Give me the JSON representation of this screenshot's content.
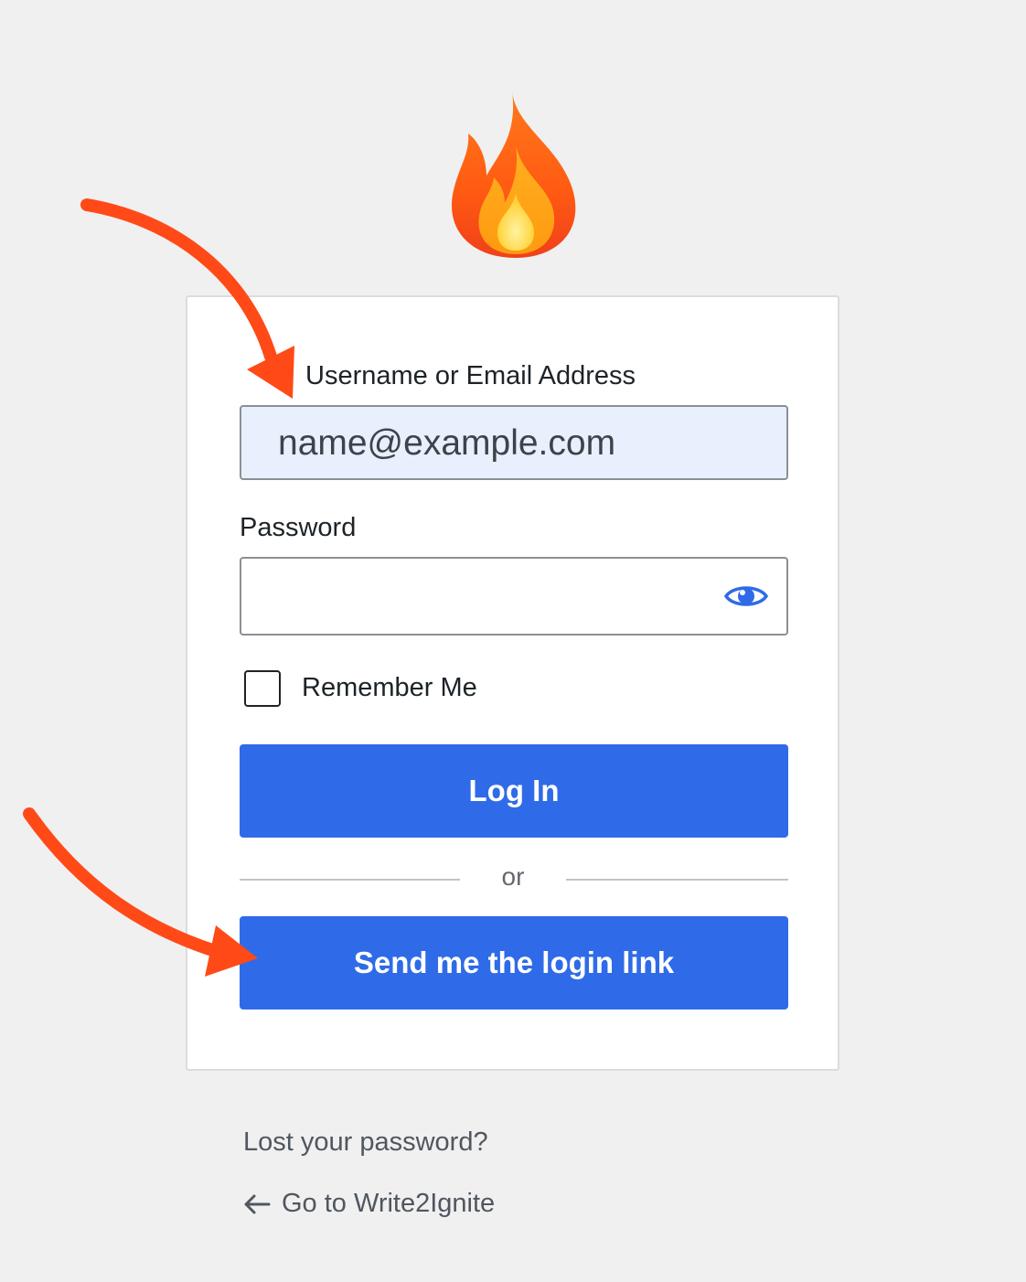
{
  "logo": {
    "icon": "fire-icon"
  },
  "form": {
    "username_label": "Username or Email Address",
    "username_value": "name@example.com",
    "password_label": "Password",
    "password_value": "",
    "show_password_icon": "eye-icon",
    "remember_label": "Remember Me",
    "remember_checked": false,
    "login_button": "Log In",
    "divider_text": "or",
    "magic_link_button": "Send me the login link"
  },
  "footer": {
    "lost_password": "Lost your password?",
    "back_link": "Go to Write2Ignite",
    "back_icon": "arrow-left-icon"
  },
  "colors": {
    "background": "#f0f0f1",
    "primary_button": "#2f6be8",
    "autofill_input": "#e8f0fe",
    "annotation_arrow": "#ff4a17",
    "eye_icon": "#2f6be8"
  }
}
